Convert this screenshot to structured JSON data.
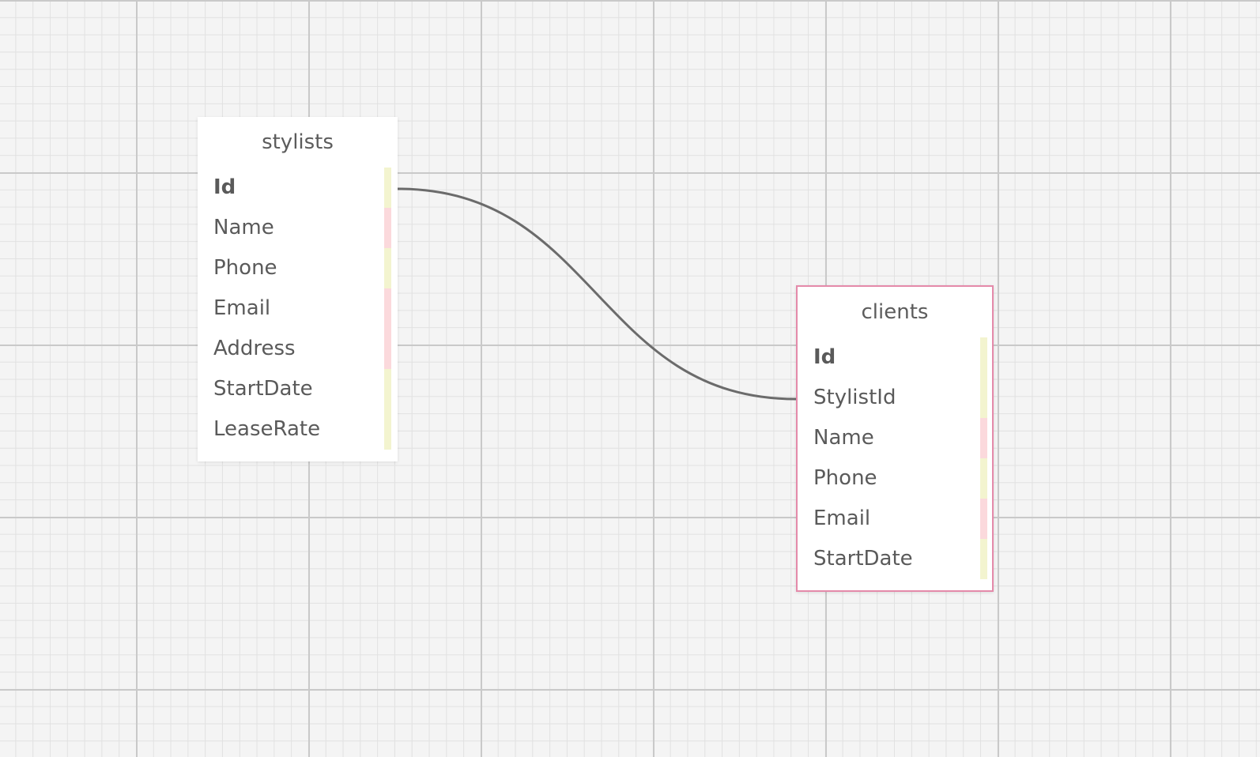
{
  "diagram": {
    "tables": [
      {
        "name": "stylists",
        "fields": [
          {
            "name": "Id",
            "primary_key": true,
            "marker": "yellow"
          },
          {
            "name": "Name",
            "primary_key": false,
            "marker": "pink"
          },
          {
            "name": "Phone",
            "primary_key": false,
            "marker": "yellow"
          },
          {
            "name": "Email",
            "primary_key": false,
            "marker": "pink"
          },
          {
            "name": "Address",
            "primary_key": false,
            "marker": "pink"
          },
          {
            "name": "StartDate",
            "primary_key": false,
            "marker": "yellow"
          },
          {
            "name": "LeaseRate",
            "primary_key": false,
            "marker": "yellow"
          }
        ]
      },
      {
        "name": "clients",
        "selected": true,
        "fields": [
          {
            "name": "Id",
            "primary_key": true,
            "marker": "yellow"
          },
          {
            "name": "StylistId",
            "primary_key": false,
            "marker": "yellow"
          },
          {
            "name": "Name",
            "primary_key": false,
            "marker": "pink"
          },
          {
            "name": "Phone",
            "primary_key": false,
            "marker": "yellow"
          },
          {
            "name": "Email",
            "primary_key": false,
            "marker": "pink"
          },
          {
            "name": "StartDate",
            "primary_key": false,
            "marker": "yellow"
          }
        ]
      }
    ],
    "relations": [
      {
        "from_table": "stylists",
        "from_field": "Id",
        "to_table": "clients",
        "to_field": "StylistId"
      }
    ]
  },
  "colors": {
    "canvas_background": "#f4f4f4",
    "grid_major": "#c9c9c9",
    "grid_minor": "#e1e1e1",
    "relation_line": "#6b6b6b",
    "selected_border": "#e48aaa",
    "marker_yellow": "#f3f4cf",
    "marker_pink": "#fbd9dc",
    "text": "#5a5a5a"
  }
}
